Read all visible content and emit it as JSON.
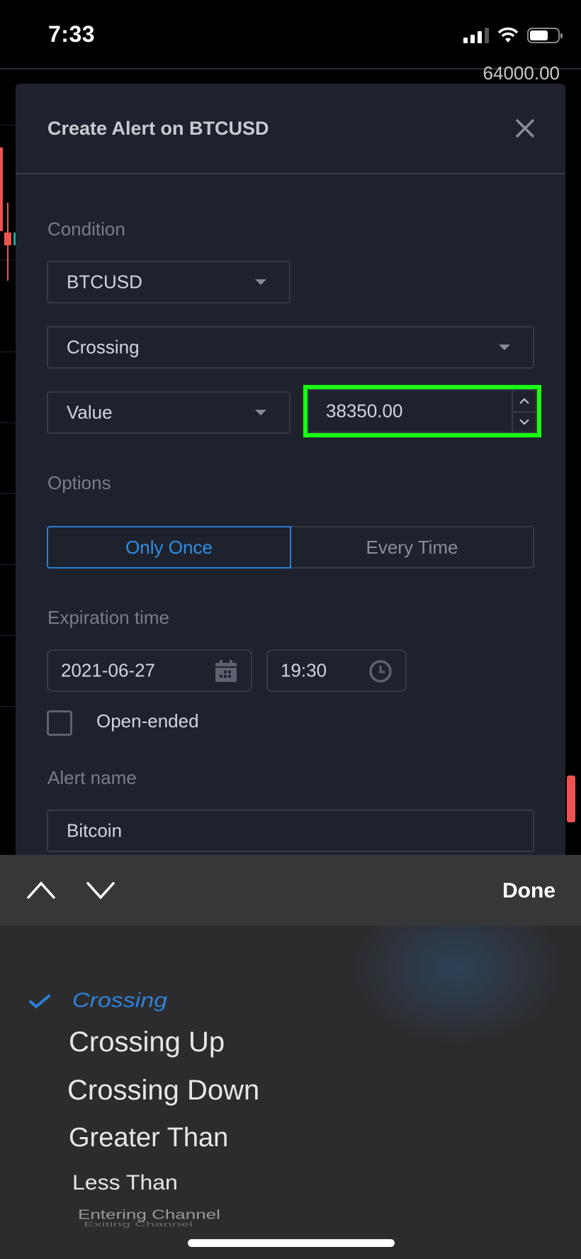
{
  "status_bar": {
    "time": "7:33",
    "signal_bars": 3,
    "battery_percent": 65
  },
  "chart": {
    "price_label": "64000.00"
  },
  "modal": {
    "title": "Create Alert on BTCUSD",
    "condition_label": "Condition",
    "symbol_select": "BTCUSD",
    "condition_select": "Crossing",
    "target_select": "Value",
    "value_input": "38350.00",
    "options_label": "Options",
    "options": [
      {
        "label": "Only Once",
        "selected": true
      },
      {
        "label": "Every Time",
        "selected": false
      }
    ],
    "expiration_label": "Expiration time",
    "expiration_date": "2021-06-27",
    "expiration_time": "19:30",
    "open_ended_label": "Open-ended",
    "open_ended_checked": false,
    "alert_name_label": "Alert name",
    "alert_name_value": "Bitcoin"
  },
  "picker": {
    "done_label": "Done",
    "items": [
      {
        "label": "Crossing",
        "selected": true
      },
      {
        "label": "Crossing Up",
        "selected": false
      },
      {
        "label": "Crossing Down",
        "selected": false
      },
      {
        "label": "Greater Than",
        "selected": false
      },
      {
        "label": "Less Than",
        "selected": false
      },
      {
        "label": "Entering Channel",
        "selected": false
      },
      {
        "label": "Exiting Channel",
        "selected": false
      }
    ]
  },
  "colors": {
    "accent": "#2f8de4",
    "highlight": "#18ff12",
    "modal_bg": "#1e222d",
    "candle_red": "#ef5350"
  }
}
